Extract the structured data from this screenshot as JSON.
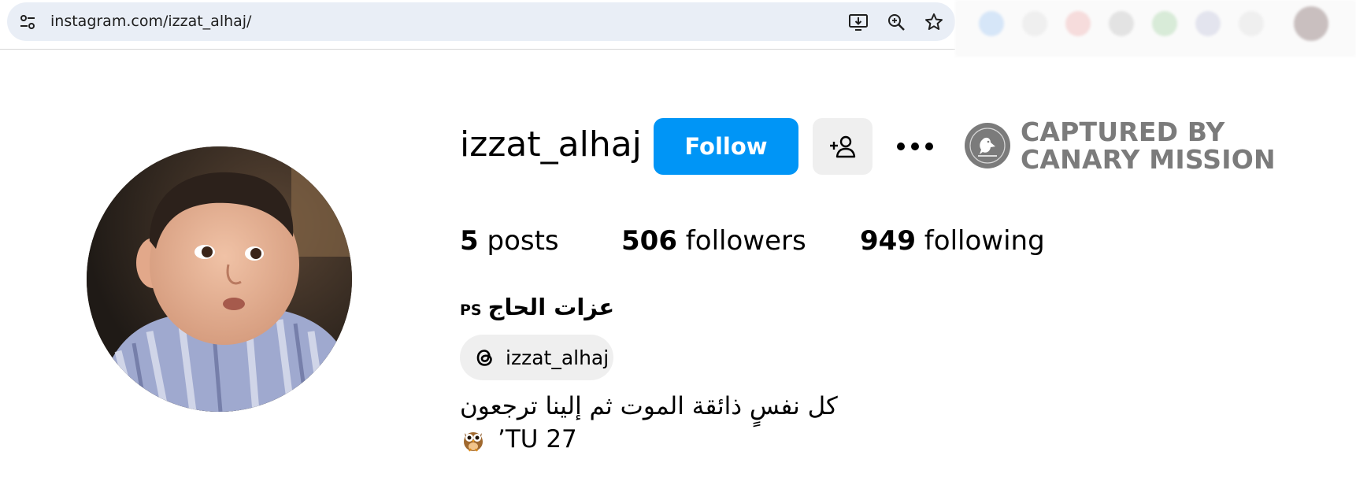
{
  "browser": {
    "url": "instagram.com/izzat_alhaj/",
    "icons": [
      "tune-icon",
      "install-app-icon",
      "zoom-icon",
      "bookmark-star-icon"
    ]
  },
  "profile": {
    "username": "izzat_alhaj",
    "follow_label": "Follow",
    "stats": {
      "posts_count": "5",
      "posts_label": "posts",
      "followers_count": "506",
      "followers_label": "followers",
      "following_count": "949",
      "following_label": "following"
    },
    "full_name": "عزات الحاج",
    "name_suffix": "PS",
    "threads_handle": "izzat_alhaj",
    "bio_line1": "كل نفسٍ ذائقة الموت ثم إلينا ترجعون",
    "bio_line2": "’TU 27"
  },
  "watermark": {
    "line1": "CAPTURED BY",
    "line2": "CANARY MISSION"
  },
  "colors": {
    "accent": "#0095f6",
    "secondary_button": "#efefef",
    "address_bar": "#e9eef6",
    "watermark": "#7b7b7b"
  }
}
